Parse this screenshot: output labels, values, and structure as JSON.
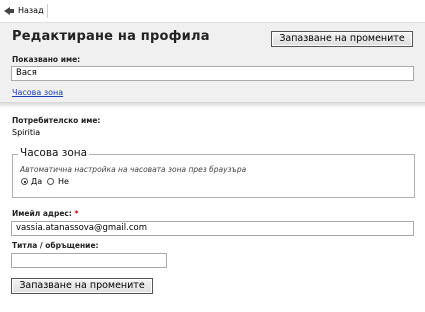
{
  "nav": {
    "back_label": "Назад"
  },
  "header": {
    "title": "Редактиране на профила",
    "save_label": "Запазване на промените"
  },
  "display_name": {
    "label": "Показвано име:",
    "value": "Вася"
  },
  "timezone_link": "Часова зона",
  "username": {
    "label": "Потребителско име:",
    "value": "Spiritia"
  },
  "timezone": {
    "legend": "Часова зона",
    "note": "Автоматична настройка на часовата зона през браузъра",
    "options": [
      {
        "label": "Да",
        "selected": true
      },
      {
        "label": "Не",
        "selected": false
      }
    ]
  },
  "email": {
    "label": "Имейл адрес:",
    "required_mark": "*",
    "value": "vassia.atanassova@gmail.com"
  },
  "title_field": {
    "label": "Титла / обръщение:",
    "value": ""
  },
  "footer": {
    "save_label": "Запазване на промените"
  }
}
